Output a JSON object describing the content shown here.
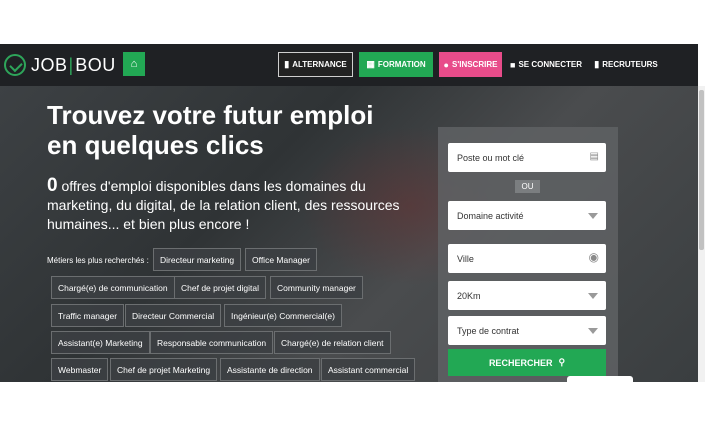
{
  "brand": {
    "name_left": "JOB",
    "name_right": "BOU",
    "separator": "|"
  },
  "nav": {
    "home_icon": "home-icon",
    "alternance": "ALTERNANCE",
    "formation": "FORMATION",
    "inscrire": "S'INSCRIRE",
    "connecter": "SE CONNECTER",
    "recruteurs": "RECRUTEURS"
  },
  "hero": {
    "title": "Trouvez votre futur emploi en quelques clics",
    "count": "0",
    "subtitle": " offres d'emploi disponibles dans les domaines du marketing, du digital, de la relation client, des ressources humaines... et bien plus encore !",
    "jobs_label": "Métiers les plus recherchés :",
    "tags": [
      "Directeur marketing",
      "Office Manager",
      "Chargé(e) de communication",
      "Chef de projet digital",
      "Community manager",
      "Traffic manager",
      "Directeur Commercial",
      "Ingénieur(e) Commercial(e)",
      "Assistant(e) Marketing",
      "Responsable communication",
      "Chargé(e) de relation client",
      "Webmaster",
      "Chef de projet Marketing",
      "Assistante de direction",
      "Assistant commercial"
    ]
  },
  "search": {
    "keyword_placeholder": "Poste ou mot clé",
    "or_label": "OU",
    "domain": "Domaine activité",
    "city": "Ville",
    "distance": "20Km",
    "contract": "Type de contrat",
    "submit": "RECHERCHER"
  },
  "colors": {
    "green": "#22a854",
    "pink": "#e84c8a",
    "dark": "#1f2124"
  }
}
